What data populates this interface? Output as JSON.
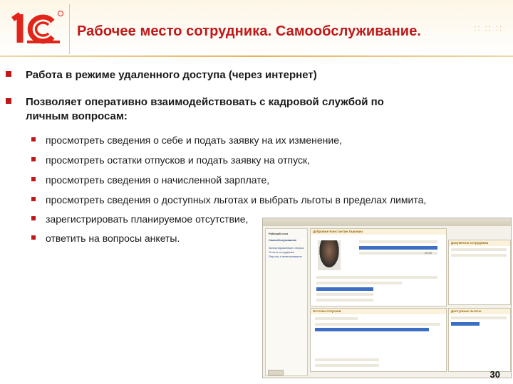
{
  "header": {
    "logo_text": "1С",
    "title": "Рабочее место сотрудника. Самообслуживание.",
    "decoration": "::  ::  ::"
  },
  "bullets_main": [
    "Работа в режиме удаленного доступа (через интернет)",
    "Позволяет оперативно взаимодействовать с кадровой службой по",
    "личным вопросам:"
  ],
  "bullets_sub": [
    "просмотреть сведения о себе и подать заявку на их изменение,",
    "просмотреть остатки отпусков и подать заявку на отпуск,",
    "просмотреть сведения о начисленной зарплате,",
    "просмотреть сведения о доступных льготах и выбрать льготы в пределах лимита,",
    "зарегистрировать планируемое отсутствие,",
    "ответить на вопросы анкеты."
  ],
  "screenshot": {
    "sidebar_title": "Рабочий стол",
    "sidebar_link": "Самообслуживание",
    "sidebar_items": [
      "Запланированные отпуска",
      "Отчеты сотрудника",
      "Опросы и анкетирование"
    ],
    "panel_employee": "Дубровин Константин Львович",
    "panel_requests": "Документы сотрудника",
    "panel_vacation": "Остатки отпусков",
    "panel_benefits": "Доступные льготы",
    "vacation_value": "20,00"
  },
  "page_number": "30",
  "colors": {
    "accent": "#c01818",
    "logo_red": "#e1251b",
    "gold": "#e8b35e"
  }
}
